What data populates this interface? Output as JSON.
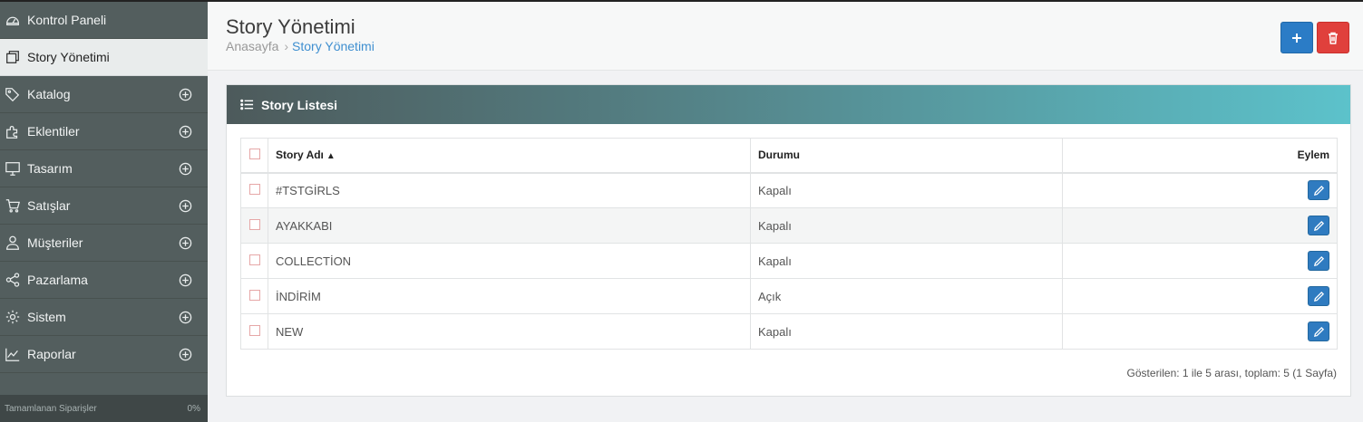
{
  "sidebar": {
    "items": [
      {
        "label": "Kontrol Paneli",
        "icon": "dashboard-icon",
        "expandable": false
      },
      {
        "label": "Story Yönetimi",
        "icon": "story-icon",
        "expandable": false,
        "active": true
      },
      {
        "label": "Katalog",
        "icon": "tag-icon",
        "expandable": true
      },
      {
        "label": "Eklentiler",
        "icon": "puzzle-icon",
        "expandable": true
      },
      {
        "label": "Tasarım",
        "icon": "monitor-icon",
        "expandable": true
      },
      {
        "label": "Satışlar",
        "icon": "cart-icon",
        "expandable": true
      },
      {
        "label": "Müşteriler",
        "icon": "user-icon",
        "expandable": true
      },
      {
        "label": "Pazarlama",
        "icon": "share-icon",
        "expandable": true
      },
      {
        "label": "Sistem",
        "icon": "gear-icon",
        "expandable": true
      },
      {
        "label": "Raporlar",
        "icon": "chart-icon",
        "expandable": true
      }
    ],
    "footer": {
      "label": "Tamamlanan Siparişler",
      "value": "0%"
    }
  },
  "header": {
    "title": "Story Yönetimi",
    "breadcrumb": {
      "home": "Anasayfa",
      "separator": "›",
      "current": "Story Yönetimi"
    }
  },
  "panel": {
    "title": "Story Listesi",
    "columns": {
      "name": "Story Adı",
      "status": "Durumu",
      "action": "Eylem"
    },
    "rows": [
      {
        "name": "#TSTGİRLS",
        "status": "Kapalı"
      },
      {
        "name": "AYAKKABI",
        "status": "Kapalı"
      },
      {
        "name": "COLLECTİON",
        "status": "Kapalı"
      },
      {
        "name": "İNDİRİM",
        "status": "Açık"
      },
      {
        "name": "NEW",
        "status": "Kapalı"
      }
    ],
    "summary": "Gösterilen: 1 ile 5 arası, toplam: 5 (1 Sayfa)"
  },
  "colors": {
    "sidebar_bg": "#535e5e",
    "primary": "#2b7cc6",
    "danger": "#e0403c",
    "heading_gradient_end": "#5cc2cb"
  }
}
